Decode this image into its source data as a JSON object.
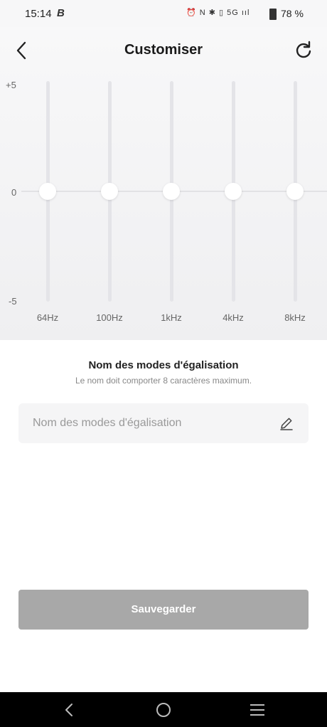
{
  "status_bar": {
    "time": "15:14",
    "app_glyph": "B",
    "icons": "⏰ N ✱ ▯ 5G ııl",
    "battery_percent": "78 %"
  },
  "header": {
    "title": "Customiser",
    "back_icon": "chevron-left-icon",
    "reset_icon": "refresh-icon"
  },
  "equalizer": {
    "scale_max_label": "+5",
    "scale_zero_label": "0",
    "scale_min_label": "-5",
    "bands": [
      {
        "label": "64Hz",
        "gain": 0
      },
      {
        "label": "100Hz",
        "gain": 0
      },
      {
        "label": "1kHz",
        "gain": 0
      },
      {
        "label": "4kHz",
        "gain": 0
      },
      {
        "label": "8kHz",
        "gain": 0
      }
    ]
  },
  "mode_name": {
    "title": "Nom des modes d'égalisation",
    "hint": "Le nom doit comporter 8 caractères maximum.",
    "placeholder": "Nom des modes d'égalisation",
    "value": "",
    "edit_icon": "pencil-icon"
  },
  "save_button": {
    "label": "Sauvegarder"
  },
  "nav_bar": {
    "back_icon": "back-icon",
    "home_icon": "home-icon",
    "recents_icon": "menu-icon"
  },
  "colors": {
    "eq_background": "#f2f2f4",
    "knob": "#ffffff",
    "track": "#e4e4e8",
    "save_disabled": "#a8a8a8"
  }
}
